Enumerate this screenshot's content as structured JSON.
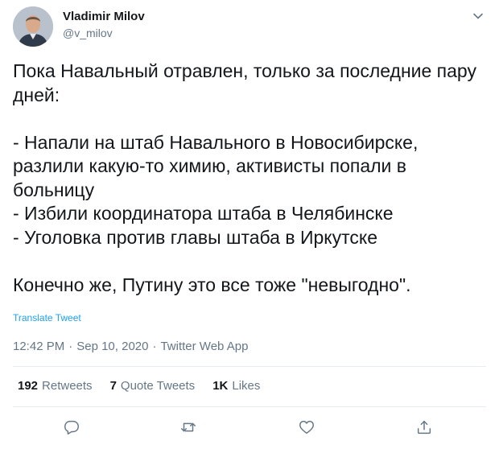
{
  "author": {
    "name": "Vladimir Milov",
    "handle": "@v_milov"
  },
  "tweet": {
    "text": "Пока Навальный отравлен, только за последние пару\nдней:\n\n- Напали на штаб Навального в Новосибирске,\nразлили какую-то химию, активисты попали в\nбольницу\n- Избили координатора штаба в Челябинске\n- Уголовка против главы штаба в Иркутске\n\nКонечно же, Путину это все тоже \"невыгодно\".",
    "translate_label": "Translate Tweet",
    "time": "12:42 PM",
    "date": "Sep 10, 2020",
    "separator": "·",
    "source": "Twitter Web App"
  },
  "stats": {
    "retweets_count": "192",
    "retweets_label": "Retweets",
    "quotes_count": "7",
    "quotes_label": "Quote Tweets",
    "likes_count": "1K",
    "likes_label": "Likes"
  },
  "icons": {
    "caret": "chevron-down-icon",
    "reply": "reply-icon",
    "retweet": "retweet-icon",
    "like": "heart-icon",
    "share": "share-icon"
  },
  "colors": {
    "text": "#14171a",
    "secondary": "#657786",
    "link": "#1da1f2",
    "divider": "#e6ecf0"
  }
}
